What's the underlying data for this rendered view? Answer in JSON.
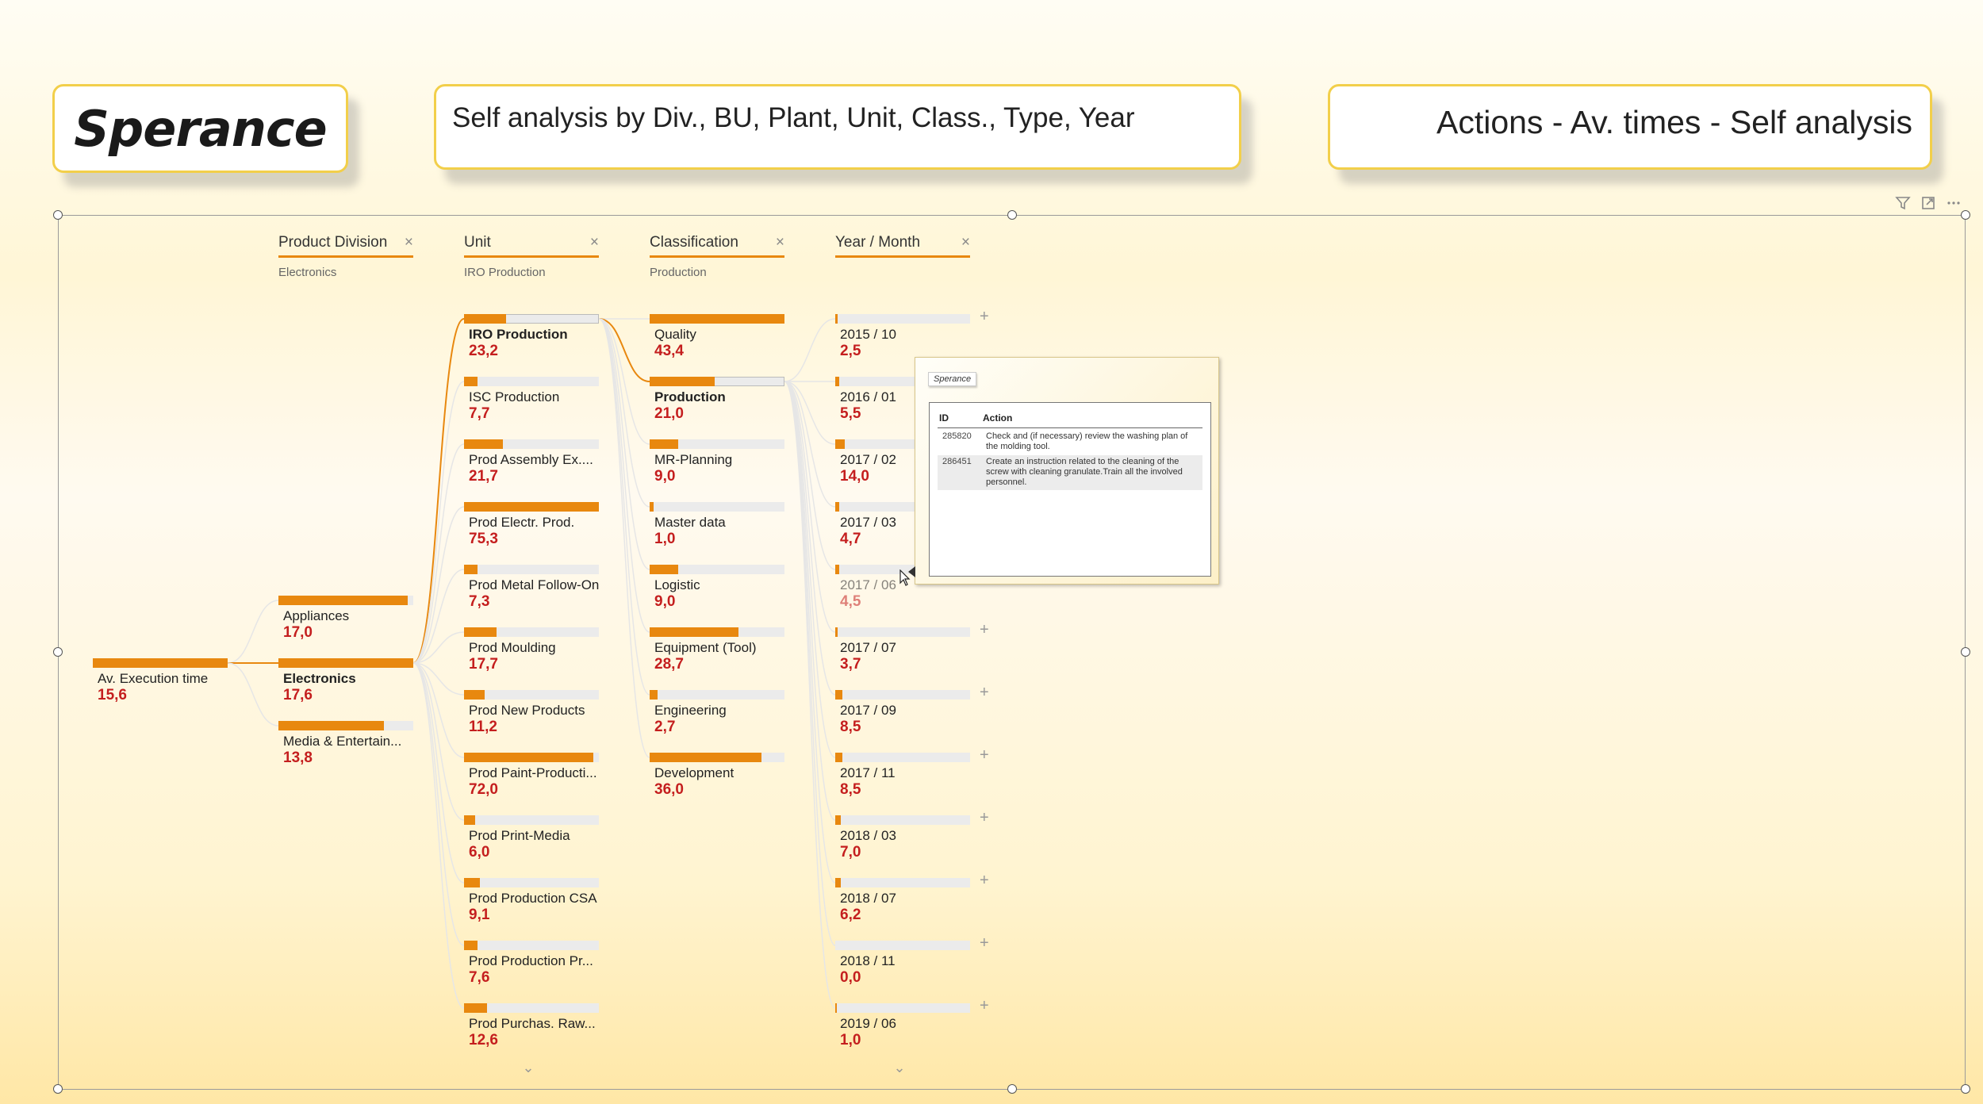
{
  "header": {
    "logo": "Sperance",
    "subtitle": "Self analysis by Div., BU, Plant, Unit, Class., Type, Year",
    "title": "Actions - Av. times - Self analysis"
  },
  "visual": {
    "icons": [
      "filter-icon",
      "focus-mode-icon",
      "more-options-icon"
    ],
    "accent_color": "#e8880f",
    "value_color": "#c41e1e"
  },
  "columns": [
    {
      "title": "Product Division",
      "selected": "Electronics"
    },
    {
      "title": "Unit",
      "selected": "IRO Production"
    },
    {
      "title": "Classification",
      "selected": "Production"
    },
    {
      "title": "Year / Month",
      "selected": ""
    }
  ],
  "root": {
    "label": "Av. Execution time",
    "value": "15,6",
    "fill": 1.0
  },
  "divisions": [
    {
      "label": "Appliances",
      "value": "17,0",
      "fill": 0.96,
      "selected": false
    },
    {
      "label": "Electronics",
      "value": "17,6",
      "fill": 1.0,
      "selected": true
    },
    {
      "label": "Media & Entertain...",
      "value": "13,8",
      "fill": 0.78,
      "selected": false
    }
  ],
  "units": [
    {
      "label": "IRO Production",
      "value": "23,2",
      "fill": 0.31,
      "selected": true
    },
    {
      "label": "ISC Production",
      "value": "7,7",
      "fill": 0.1,
      "selected": false
    },
    {
      "label": "Prod Assembly Ex....",
      "value": "21,7",
      "fill": 0.29,
      "selected": false
    },
    {
      "label": "Prod Electr. Prod.",
      "value": "75,3",
      "fill": 1.0,
      "selected": false
    },
    {
      "label": "Prod Metal Follow-On",
      "value": "7,3",
      "fill": 0.1,
      "selected": false
    },
    {
      "label": "Prod Moulding",
      "value": "17,7",
      "fill": 0.24,
      "selected": false
    },
    {
      "label": "Prod New Products",
      "value": "11,2",
      "fill": 0.15,
      "selected": false
    },
    {
      "label": "Prod Paint-Producti...",
      "value": "72,0",
      "fill": 0.96,
      "selected": false
    },
    {
      "label": "Prod Print-Media",
      "value": "6,0",
      "fill": 0.08,
      "selected": false
    },
    {
      "label": "Prod Production CSA",
      "value": "9,1",
      "fill": 0.12,
      "selected": false
    },
    {
      "label": "Prod Production Pr...",
      "value": "7,6",
      "fill": 0.1,
      "selected": false
    },
    {
      "label": "Prod Purchas. Raw...",
      "value": "12,6",
      "fill": 0.17,
      "selected": false
    }
  ],
  "classifications": [
    {
      "label": "Quality",
      "value": "43,4",
      "fill": 1.0,
      "selected": false
    },
    {
      "label": "Production",
      "value": "21,0",
      "fill": 0.48,
      "selected": true
    },
    {
      "label": "MR-Planning",
      "value": "9,0",
      "fill": 0.21,
      "selected": false
    },
    {
      "label": "Master data",
      "value": "1,0",
      "fill": 0.03,
      "selected": false
    },
    {
      "label": "Logistic",
      "value": "9,0",
      "fill": 0.21,
      "selected": false
    },
    {
      "label": "Equipment (Tool)",
      "value": "28,7",
      "fill": 0.66,
      "selected": false
    },
    {
      "label": "Engineering",
      "value": "2,7",
      "fill": 0.06,
      "selected": false
    },
    {
      "label": "Development",
      "value": "36,0",
      "fill": 0.83,
      "selected": false
    }
  ],
  "periods": [
    {
      "label": "2015 / 10",
      "value": "2,5",
      "fill": 0.02
    },
    {
      "label": "2016 / 01",
      "value": "5,5",
      "fill": 0.03
    },
    {
      "label": "2017 / 02",
      "value": "14,0",
      "fill": 0.07
    },
    {
      "label": "2017 / 03",
      "value": "4,7",
      "fill": 0.03
    },
    {
      "label": "2017 / 06",
      "value": "4,5",
      "fill": 0.03,
      "dim": true
    },
    {
      "label": "2017 / 07",
      "value": "3,7",
      "fill": 0.02
    },
    {
      "label": "2017 / 09",
      "value": "8,5",
      "fill": 0.05
    },
    {
      "label": "2017 / 11",
      "value": "8,5",
      "fill": 0.05
    },
    {
      "label": "2018 / 03",
      "value": "7,0",
      "fill": 0.04
    },
    {
      "label": "2018 / 07",
      "value": "6,2",
      "fill": 0.04
    },
    {
      "label": "2018 / 11",
      "value": "0,0",
      "fill": 0.0
    },
    {
      "label": "2019 / 06",
      "value": "1,0",
      "fill": 0.01
    }
  ],
  "tooltip": {
    "logo": "Sperance",
    "col_id": "ID",
    "col_action": "Action",
    "rows": [
      {
        "id": "285820",
        "action": "Check and (if necessary) review the washing plan of the molding tool."
      },
      {
        "id": "286451",
        "action": "Create an instruction related to the cleaning of the screw with cleaning granulate.Train all the involved personnel."
      }
    ]
  }
}
